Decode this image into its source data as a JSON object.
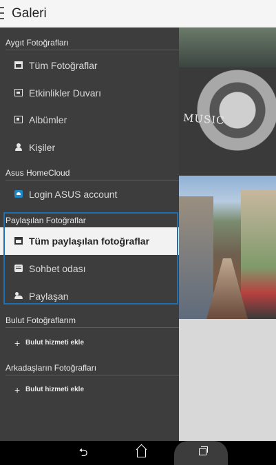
{
  "app": {
    "title": "Galeri"
  },
  "drawer": {
    "sections": {
      "device": "Aygıt Fotoğrafları",
      "homecloud": "Asus HomeCloud",
      "shared": "Paylaşılan Fotoğraflar",
      "cloud": "Bulut Fotoğraflarım",
      "friends": "Arkadaşların Fotoğrafları"
    },
    "device_items": [
      "Tüm Fotoğraflar",
      "Etkinlikler Duvarı",
      "Albümler",
      "Kişiler"
    ],
    "homecloud_items": [
      "Login ASUS account"
    ],
    "shared_items": [
      "Tüm paylaşılan fotoğraflar",
      "Sohbet odası",
      "Paylaşan"
    ],
    "cloud_add": "Bulut hizmeti ekle",
    "friends_add": "Bulut hizmeti ekle",
    "selected_item": "Tüm paylaşılan fotoğraflar"
  },
  "content": {
    "tile_text": "MUSIC"
  },
  "icons": {
    "device_items": [
      "photos-icon",
      "events-wall-icon",
      "album-icon",
      "person-icon"
    ],
    "homecloud_items": [
      "asus-cloud-icon"
    ],
    "shared_items": [
      "photos-icon",
      "chat-icon",
      "sharer-icon"
    ],
    "nav": [
      "back-icon",
      "home-icon",
      "recents-icon"
    ]
  },
  "colors": {
    "highlight": "#1f6fb5",
    "drawer_bg": "#3d3d3d",
    "selected_bg": "#f2f2f2",
    "cloud_icon": "#1e88c7"
  }
}
